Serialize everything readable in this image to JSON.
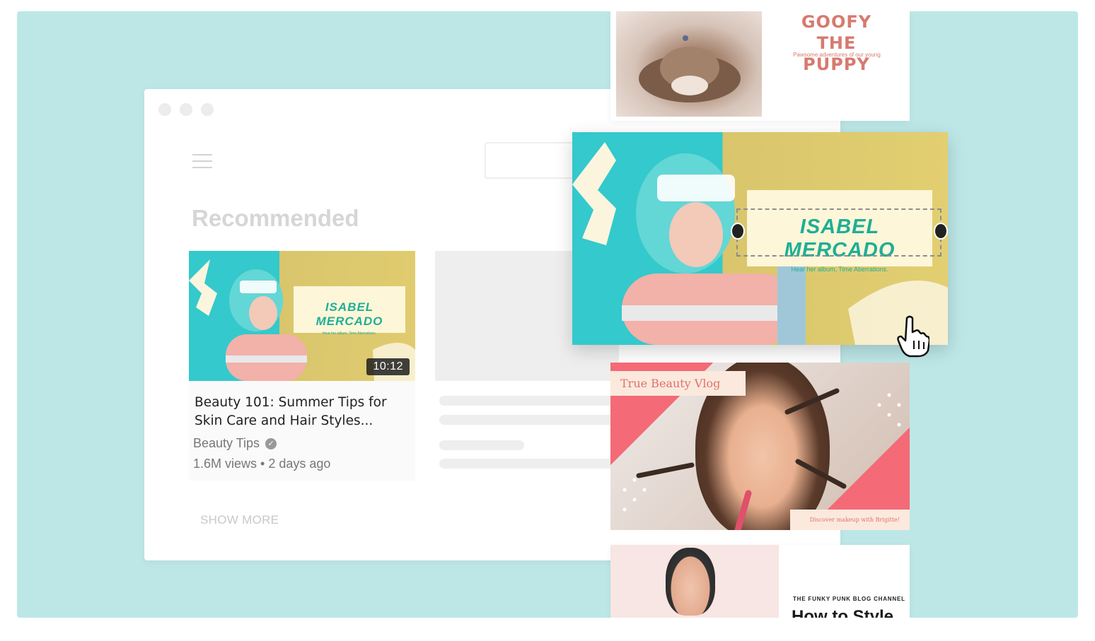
{
  "recommended": {
    "heading": "Recommended",
    "video": {
      "thumbnail": {
        "name": "ISABEL MERCADO",
        "subtitle": "Hear her album, Time Aberrations."
      },
      "duration": "10:12",
      "title": "Beauty 101: Summer Tips for Skin Care and Hair Styles...",
      "channel": "Beauty Tips",
      "views": "1.6M views",
      "age": "2 days ago"
    },
    "show_more_label": "SHOW MORE"
  },
  "cards": {
    "puppy": {
      "title": "GOOFY THE PUPPY",
      "subtitle": "Pawsome adventures of our young pup"
    },
    "isabel": {
      "name": "ISABEL MERCADO",
      "subtitle": "Hear her album, Time Aberrations."
    },
    "beauty_vlog": {
      "tag": "True Beauty Vlog",
      "caption": "Discover makeup with Brigitte!"
    },
    "funky_punk": {
      "kicker": "THE FUNKY PUNK BLOG CHANNEL",
      "headline": "How to Style"
    }
  },
  "colors": {
    "stage_background": "#bde7e7",
    "accent_teal": "#1fae96",
    "accent_coral": "#d77a6f",
    "accent_pink": "#f46a76"
  },
  "icons": [
    "hamburger-icon",
    "verified-icon",
    "hand-cursor-icon",
    "resize-handle-icon"
  ]
}
